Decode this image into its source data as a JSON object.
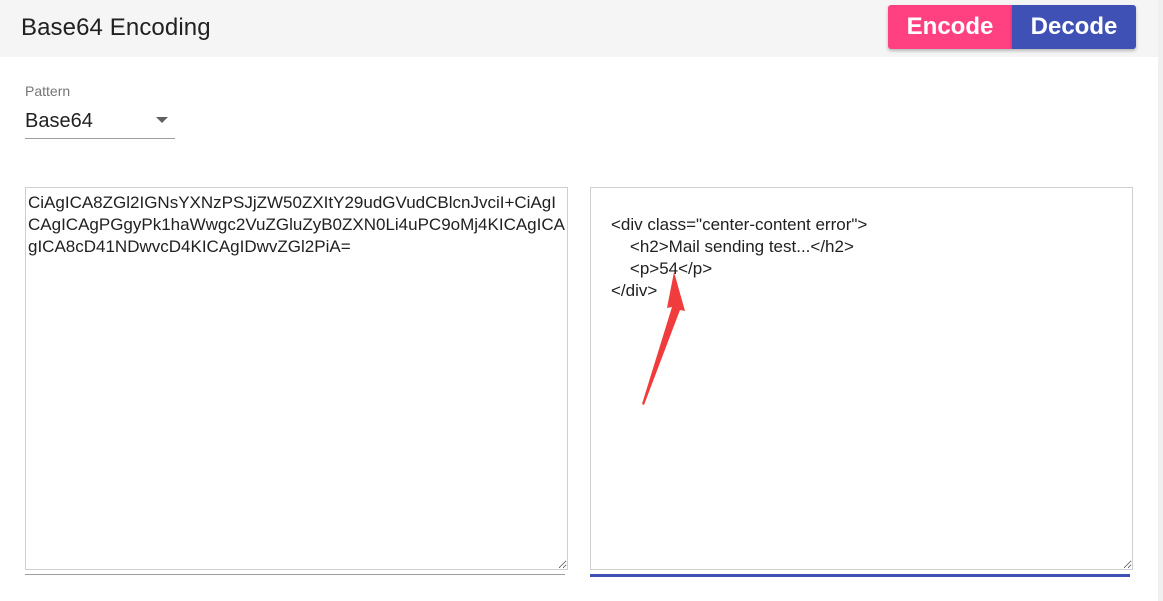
{
  "header": {
    "title": "Base64 Encoding",
    "encode_label": "Encode",
    "decode_label": "Decode"
  },
  "pattern": {
    "label": "Pattern",
    "selected": "Base64"
  },
  "input": {
    "value": "CiAgICA8ZGl2IGNsYXNzPSJjZW50ZXItY29udGVudCBlcnJvciI+CiAgICAgICAgPGgyPk1haWwgc2VuZGluZyB0ZXN0Li4uPC9oMj4KICAgICAgICA8cD41NDwvcD4KICAgIDwvZGl2PiA="
  },
  "output": {
    "value": "<div class=\"center-content error\">\n    <h2>Mail sending test...</h2>\n    <p>54</p>\n</div>"
  },
  "colors": {
    "encode": "#ff4081",
    "decode": "#3f51b5",
    "annotation": "#f03c3c"
  }
}
